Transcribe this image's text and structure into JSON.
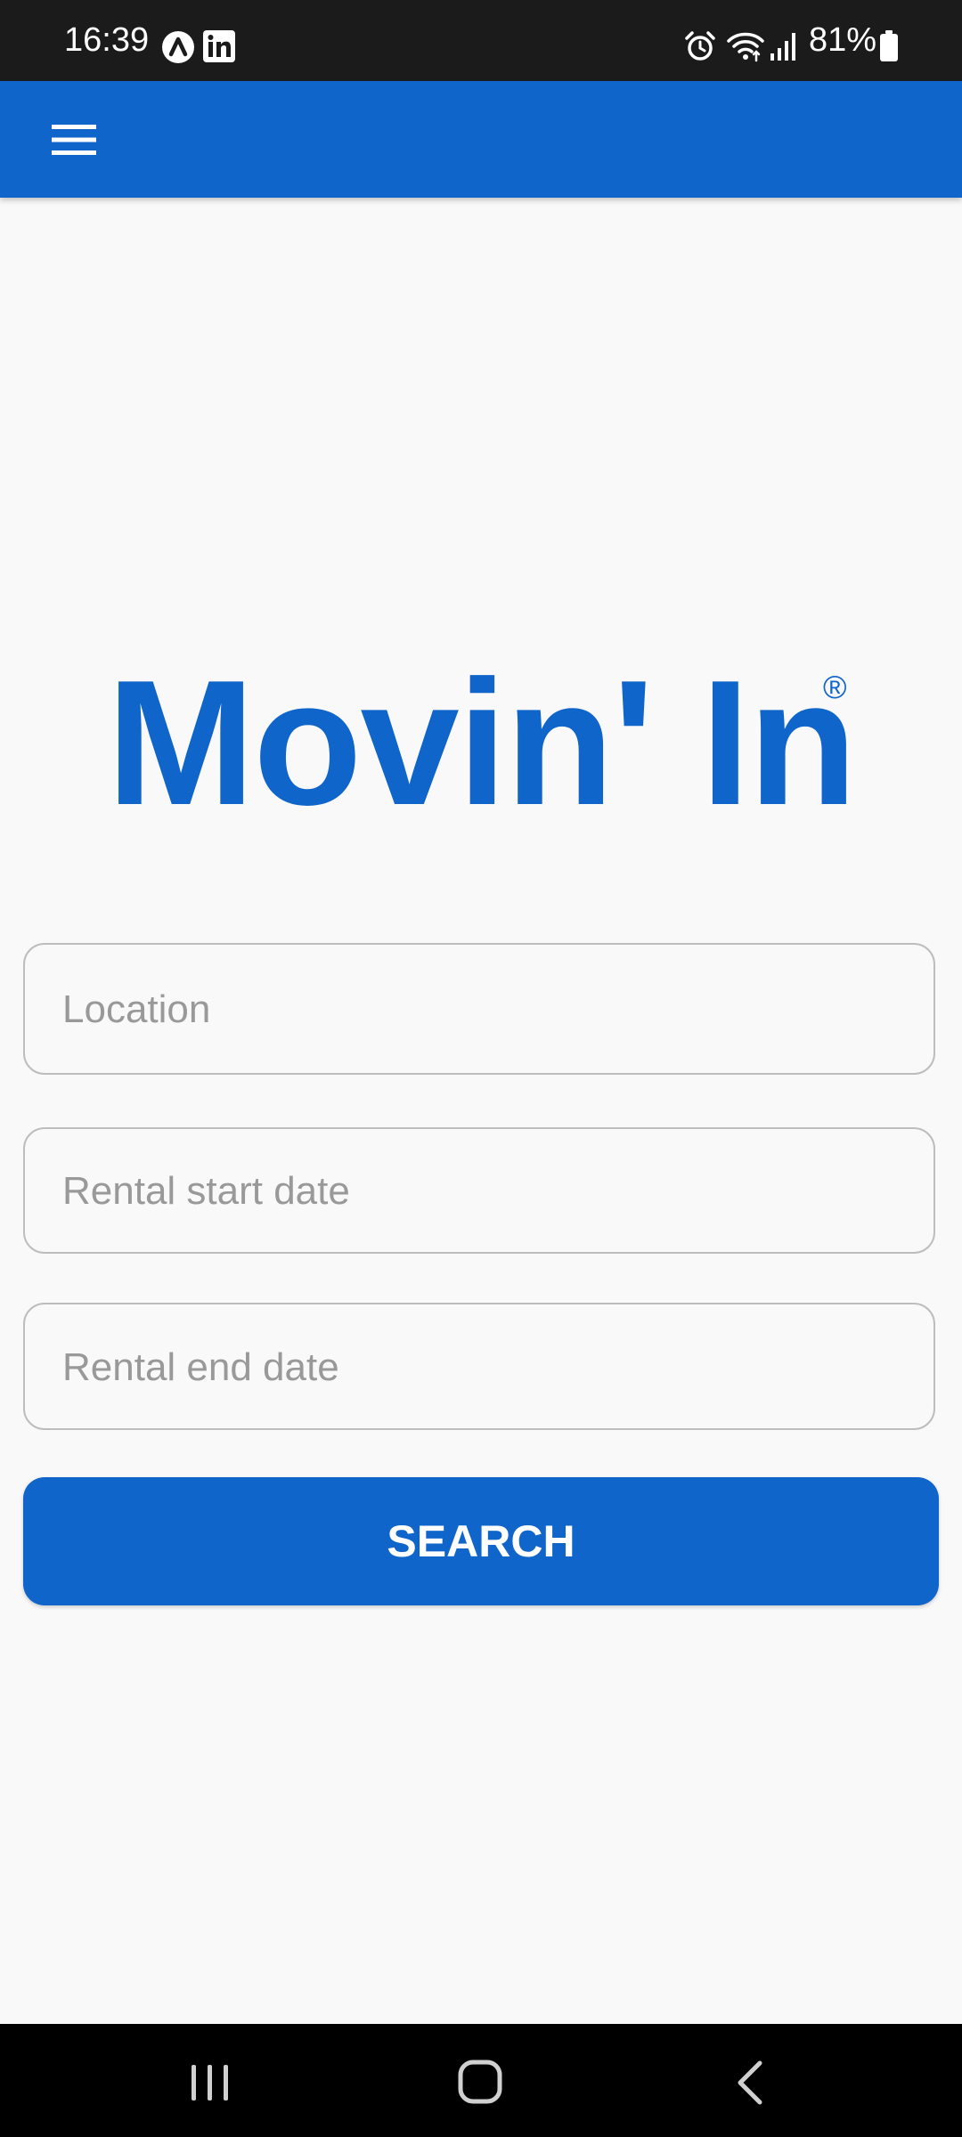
{
  "status_bar": {
    "time": "16:39",
    "left_icons": [
      "navigation-arrow-icon",
      "linkedin-icon"
    ],
    "right_icons": [
      "alarm-icon",
      "wifi-icon",
      "signal-icon",
      "battery-icon"
    ],
    "battery_percent": "81%"
  },
  "app_bar": {
    "color": "#1065cb",
    "menu_icon": "hamburger-menu-icon"
  },
  "brand": {
    "name": "Movin' In",
    "registered_mark": "®",
    "color": "#1065cb"
  },
  "search_form": {
    "location": {
      "placeholder": "Location",
      "value": ""
    },
    "start_date": {
      "placeholder": "Rental start date",
      "value": ""
    },
    "end_date": {
      "placeholder": "Rental end date",
      "value": ""
    },
    "submit_label": "SEARCH"
  },
  "nav_bar": {
    "buttons": [
      "recent-apps-icon",
      "home-icon",
      "back-icon"
    ]
  }
}
